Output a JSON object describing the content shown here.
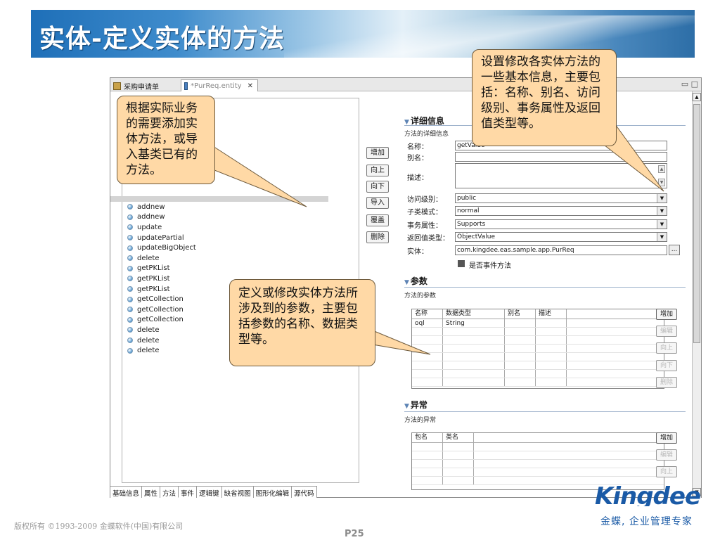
{
  "slide": {
    "title": "实体-定义实体的方法",
    "copyright": "版权所有 ©1993-2009 金蝶软件(中国)有限公司",
    "page": "P25",
    "logo": "Kingdee",
    "slogan": "金蝶, 企业管理专家"
  },
  "editor": {
    "tabs": [
      {
        "label": "采购申请单"
      },
      {
        "label": "*PurReq.entity"
      }
    ],
    "methods": [
      "addnew",
      "addnew",
      "update",
      "updatePartial",
      "updateBigObject",
      "delete",
      "getPKList",
      "getPKList",
      "getPKList",
      "getCollection",
      "getCollection",
      "getCollection",
      "delete",
      "delete",
      "delete"
    ],
    "buttons": [
      "增加",
      "向上",
      "向下",
      "导入",
      "覆盖",
      "删除"
    ],
    "bottom_tabs": [
      "基础信息",
      "属性",
      "方法",
      "事件",
      "逻辑键",
      "缺省视图",
      "图形化编辑",
      "源代码"
    ]
  },
  "details": {
    "section_title": "详细信息",
    "section_sub": "方法的详细信息",
    "name_label": "名称：",
    "name_value": "getValue",
    "alias_label": "别名：",
    "desc_label": "描述：",
    "access_label": "访问级别：",
    "access_value": "public",
    "subclass_label": "子类模式：",
    "subclass_value": "normal",
    "trans_label": "事务属性：",
    "trans_value": "Supports",
    "return_label": "返回值类型：",
    "return_value": "ObjectValue",
    "entity_label": "实体：",
    "entity_value": "com.kingdee.eas.sample.app.PurReq",
    "ellipsis": "...",
    "event_label": "是否事件方法"
  },
  "params": {
    "section_title": "参数",
    "section_sub": "方法的参数",
    "columns": [
      "名称",
      "数据类型",
      "别名",
      "描述"
    ],
    "rows": [
      [
        "oql",
        "String",
        "",
        ""
      ]
    ],
    "buttons": [
      "增加",
      "编辑",
      "向上",
      "向下",
      "删除"
    ]
  },
  "exceptions": {
    "section_title": "异常",
    "section_sub": "方法的异常",
    "columns": [
      "包名",
      "类名"
    ],
    "buttons": [
      "增加",
      "编辑",
      "向上"
    ]
  },
  "callouts": {
    "left": "根据实际业务的需要添加实体方法，或导入基类已有的方法。",
    "right": "设置修改各实体方法的一些基本信息，主要包括：名称、别名、访问级别、事务属性及返回值类型等。",
    "middle": "定义或修改实体方法所涉及到的参数，主要包括参数的名称、数据类型等。"
  }
}
